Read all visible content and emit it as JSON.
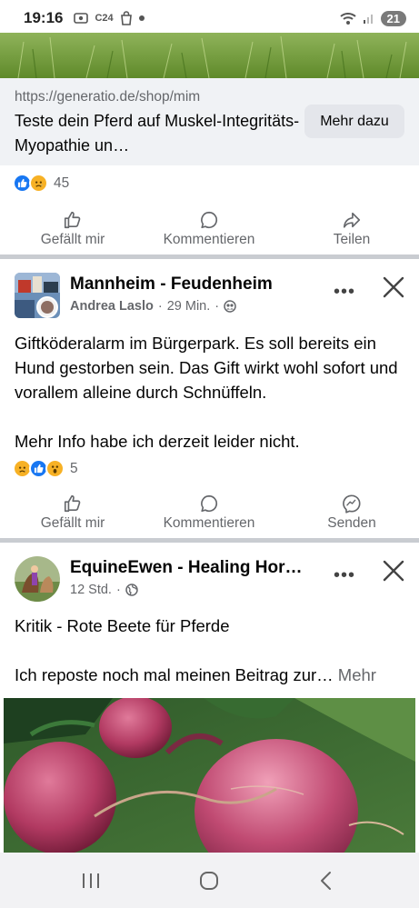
{
  "status_bar": {
    "time": "19:16",
    "left_icons": [
      "screenshot-icon",
      "c24-badge",
      "bag-icon",
      "dot"
    ],
    "c24_label": "C24",
    "battery": "21"
  },
  "ad": {
    "url": "https://generatio.de/shop/mim",
    "title": "Teste dein Pferd auf Muskel-Integritäts-Myopathie un…",
    "cta_label": "Mehr dazu"
  },
  "post1_footer": {
    "reactions": [
      "like",
      "sad"
    ],
    "reaction_count": "45",
    "actions": {
      "like": "Gefällt mir",
      "comment": "Kommentieren",
      "share": "Teilen"
    }
  },
  "post2": {
    "group": "Mannheim - Feudenheim",
    "author": "Andrea Laslo",
    "time": "29 Min.",
    "text_line1": "Giftköderalarm im Bürgerpark. Es soll bereits ein Hund gestorben sein. Das Gift wirkt wohl sofort und vorallem alleine durch Schnüffeln.",
    "text_line2": "Mehr Info habe ich derzeit leider nicht.",
    "reactions": [
      "sad",
      "like",
      "wow"
    ],
    "reaction_count": "5",
    "actions": {
      "like": "Gefällt mir",
      "comment": "Kommentieren",
      "send": "Senden"
    }
  },
  "post3": {
    "page_name": "EquineEwen - Healing Hor…",
    "time": "12 Std.",
    "text_line1": "Kritik - Rote Beete für Pferde",
    "text_line2": "Ich reposte noch mal meinen Beitrag zur…",
    "more_label": "Mehr"
  },
  "colors": {
    "brand_blue": "#1877f2",
    "secondary_text": "#65676b",
    "link_bg": "#f0f2f5",
    "divider": "#c9ccd1"
  },
  "nav": [
    "recent-apps-icon",
    "home-icon",
    "back-icon"
  ]
}
